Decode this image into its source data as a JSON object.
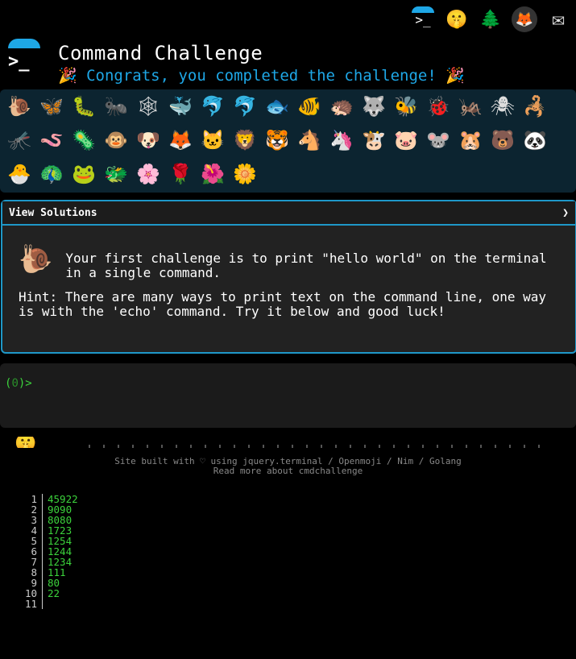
{
  "top_icons": [
    "terminal-icon",
    "shush-face-icon",
    "tree-icon",
    "gitlab-icon",
    "mail-icon"
  ],
  "header": {
    "title": "Command Challenge",
    "subtitle": "🎉 Congrats, you completed the challenge! 🎉"
  },
  "challenge_icons": [
    [
      "🐌",
      "🦋",
      "🐛",
      "🐜",
      "🕸",
      "🐳",
      "🐬",
      "🐬",
      "🐟",
      "🐠",
      "🦔",
      "🐺",
      "🐝",
      "🐞",
      "🦗",
      "🕷",
      "🦂"
    ],
    [
      "🦟",
      "🪱",
      "🦠",
      "🐵",
      "🐶",
      "🦊",
      "🐱",
      "🦁",
      "🐯",
      "🐴",
      "🦄",
      "🐮",
      "🐷",
      "🐭",
      "🐹",
      "🐻",
      "🐼"
    ],
    [
      "🐣",
      "🦚",
      "🐸",
      "🐲",
      "🌸",
      "🌹",
      "🌺",
      "🌼"
    ]
  ],
  "panel": {
    "title": "View Solutions",
    "chevron": "❯",
    "challenge_text": "Your first challenge is to print \"hello world\" on the terminal in a single command.",
    "hint_text": "Hint: There are many ways to print text on the command line, one way is with the 'echo' command. Try it below and good luck!"
  },
  "terminal": {
    "prompt_open": "(",
    "prompt_zero": "0",
    "prompt_close": ")>"
  },
  "footer": {
    "line1": "Site built with ♡ using jquery.terminal / Openmoji / Nim / Golang",
    "line2": "Read more about cmdchallenge"
  },
  "output_lines": [
    {
      "ln": "1",
      "val": "45922"
    },
    {
      "ln": "2",
      "val": "9090"
    },
    {
      "ln": "3",
      "val": "8080"
    },
    {
      "ln": "4",
      "val": "1723"
    },
    {
      "ln": "5",
      "val": "1254"
    },
    {
      "ln": "6",
      "val": "1244"
    },
    {
      "ln": "7",
      "val": "1234"
    },
    {
      "ln": "8",
      "val": "111"
    },
    {
      "ln": "9",
      "val": "80"
    },
    {
      "ln": "10",
      "val": "22"
    },
    {
      "ln": "11",
      "val": ""
    }
  ]
}
